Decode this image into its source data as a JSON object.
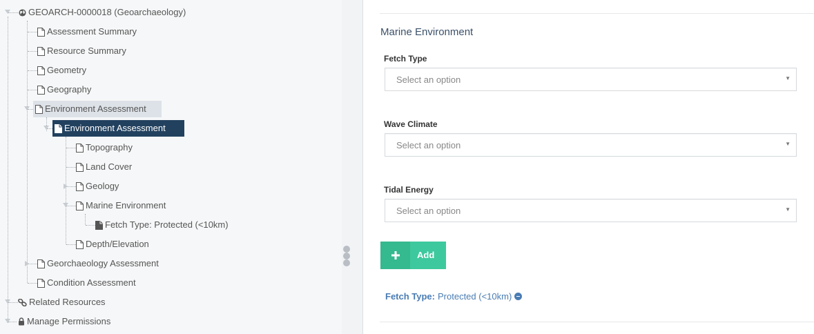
{
  "tree": {
    "root": {
      "label": "GEOARCH-0000018 (Geoarchaeology)",
      "icon": "globe-icon"
    },
    "nodes": [
      {
        "label": "Assessment Summary",
        "icon": "file-icon"
      },
      {
        "label": "Resource Summary",
        "icon": "file-icon"
      },
      {
        "label": "Geometry",
        "icon": "file-icon"
      },
      {
        "label": "Geography",
        "icon": "file-icon"
      },
      {
        "label": "Environment Assessment",
        "icon": "file-icon"
      },
      {
        "label": "Environment Assessment",
        "icon": "file-icon",
        "selected": true
      },
      {
        "label": "Topography",
        "icon": "file-icon"
      },
      {
        "label": "Land Cover",
        "icon": "file-icon"
      },
      {
        "label": "Geology",
        "icon": "file-icon"
      },
      {
        "label": "Marine Environment",
        "icon": "file-icon"
      },
      {
        "label": "Fetch Type: Protected (<10km)",
        "icon": "file-filled-icon"
      },
      {
        "label": "Depth/Elevation",
        "icon": "file-icon"
      },
      {
        "label": "Georchaeology Assessment",
        "icon": "file-icon"
      },
      {
        "label": "Condition Assessment",
        "icon": "file-icon"
      }
    ],
    "related": {
      "label": "Related Resources",
      "icon": "link-icon"
    },
    "permissions": {
      "label": "Manage Permissions",
      "icon": "lock-icon"
    }
  },
  "form": {
    "section_title": "Marine Environment",
    "fields": [
      {
        "label": "Fetch Type",
        "placeholder": "Select an option"
      },
      {
        "label": "Wave Climate",
        "placeholder": "Select an option"
      },
      {
        "label": "Tidal Energy",
        "placeholder": "Select an option"
      }
    ],
    "add_button": {
      "icon": "plus-icon",
      "label": "Add"
    },
    "entries": [
      {
        "key": "Fetch Type:",
        "value": "Protected (<10km)",
        "icon": "remove-circle-icon"
      }
    ]
  },
  "colors": {
    "selected_bg": "#22415f",
    "hover_bg": "#dde2e8",
    "add_button": "#3dc99d",
    "link_blue": "#4a7cb3"
  }
}
